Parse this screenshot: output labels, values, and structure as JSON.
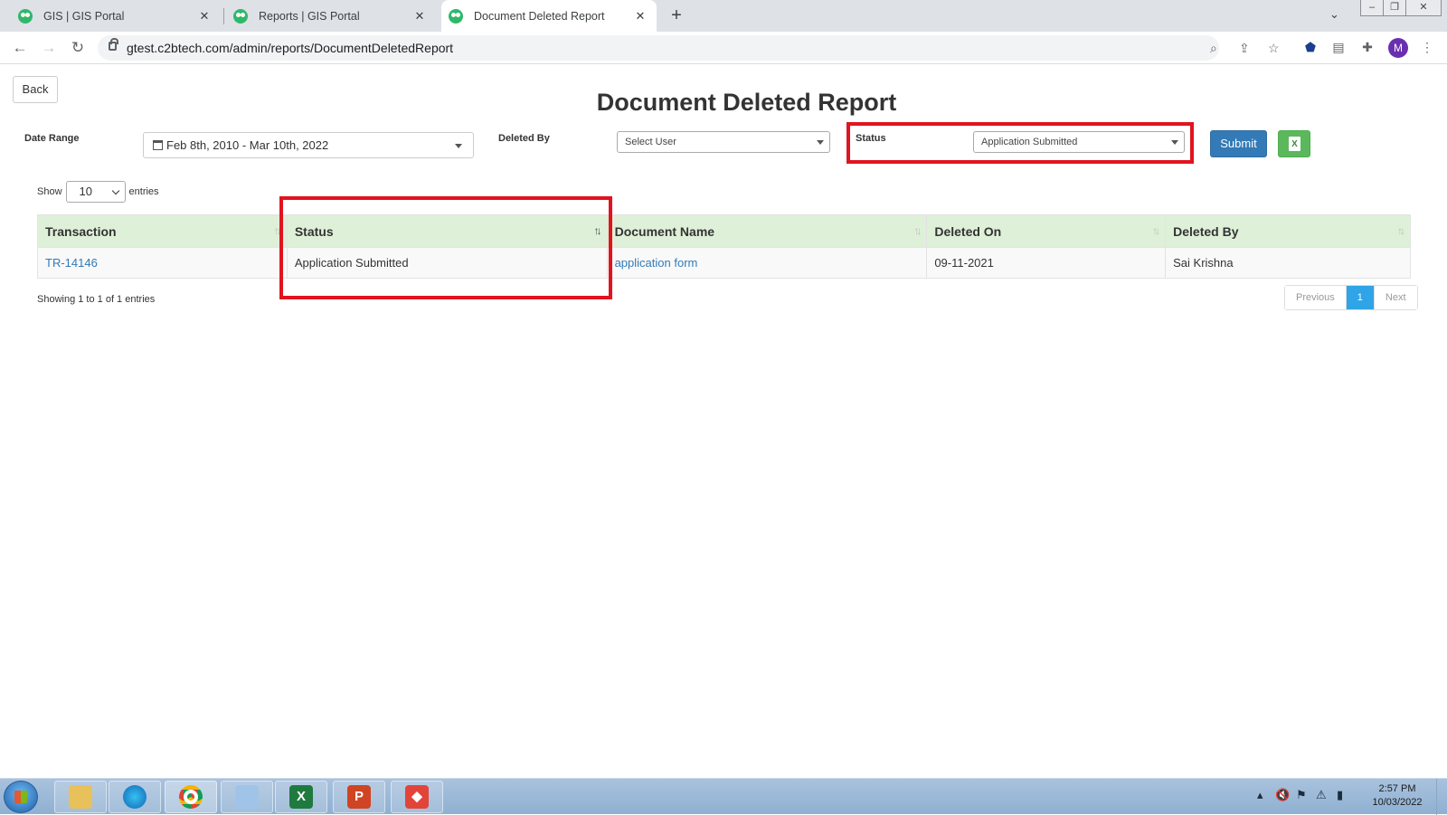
{
  "browser": {
    "tabs": [
      {
        "title": "GIS | GIS Portal",
        "active": false
      },
      {
        "title": "Reports | GIS Portal",
        "active": false
      },
      {
        "title": "Document Deleted Report",
        "active": true
      }
    ],
    "url": "gtest.c2btech.com/admin/reports/DocumentDeletedReport",
    "profile_initial": "M",
    "new_tab_symbol": "+"
  },
  "page": {
    "back_label": "Back",
    "title": "Document Deleted Report",
    "filters": {
      "date_range_label": "Date Range",
      "date_range_value": "Feb 8th, 2010 - Mar 10th, 2022",
      "deleted_by_label": "Deleted By",
      "deleted_by_value": "Select User",
      "status_label": "Status",
      "status_value": "Application Submitted",
      "submit_label": "Submit",
      "excel_icon": "excel-icon"
    },
    "length_menu": {
      "show_label": "Show",
      "value": "10",
      "entries_label": "entries"
    },
    "table": {
      "columns": [
        "Transaction",
        "Status",
        "Document Name",
        "Deleted On",
        "Deleted By"
      ],
      "rows": [
        {
          "transaction": "TR-14146",
          "status": "Application Submitted",
          "document_name": "application form",
          "deleted_on": "09-11-2021",
          "deleted_by": "Sai Krishna"
        }
      ]
    },
    "info": "Showing 1 to 1 of 1 entries",
    "pagination": {
      "previous": "Previous",
      "current": "1",
      "next": "Next"
    },
    "highlight_color": "#e0141e",
    "header_color": "#dff0d8",
    "link_color": "#337ab7"
  },
  "taskbar": {
    "time": "2:57 PM",
    "date": "10/03/2022",
    "apps": [
      "file-explorer-icon",
      "edge-icon",
      "chrome-icon",
      "notepad-icon",
      "excel-icon",
      "powerpoint-icon",
      "git-icon"
    ]
  }
}
